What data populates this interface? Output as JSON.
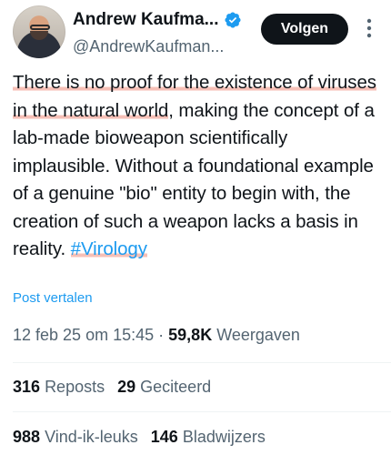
{
  "author": {
    "display_name": "Andrew Kaufma...",
    "handle": "@AndrewKaufman...",
    "follow_label": "Volgen"
  },
  "tweet": {
    "highlighted_text": "There is no proof for the existence of viruses in the natural world",
    "text_rest": ", making the concept of a lab-made bioweapon scientifically implausible. Without a foundational example of a genuine \"bio\" entity to begin with, the creation of such a weapon lacks a basis in reality. ",
    "hashtag": "#Virology",
    "translate_label": "Post vertalen"
  },
  "meta": {
    "timestamp": "12 feb 25 om 15:45",
    "separator": "·",
    "views_count": "59,8K",
    "views_label": "Weergaven"
  },
  "stats": {
    "reposts_count": "316",
    "reposts_label": "Reposts",
    "quotes_count": "29",
    "quotes_label": "Geciteerd",
    "likes_count": "988",
    "likes_label": "Vind-ik-leuks",
    "bookmarks_count": "146",
    "bookmarks_label": "Bladwijzers"
  },
  "colors": {
    "highlight": "#ef8c7c",
    "link": "#1d9bf0",
    "verified": "#1d9bf0",
    "muted": "#536471"
  },
  "icons": [
    "verified-badge-icon",
    "more-options-icon"
  ]
}
